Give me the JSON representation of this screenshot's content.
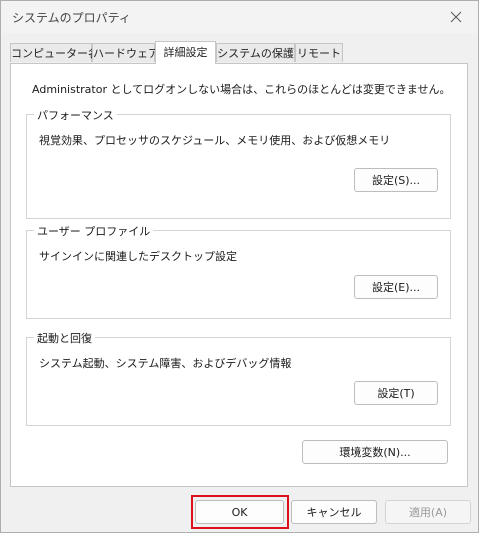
{
  "window": {
    "title": "システムのプロパティ"
  },
  "tabs": [
    {
      "label": "コンピューター名"
    },
    {
      "label": "ハードウェア"
    },
    {
      "label": "詳細設定",
      "active": true
    },
    {
      "label": "システムの保護"
    },
    {
      "label": "リモート"
    }
  ],
  "panel": {
    "note": "Administrator としてログオンしない場合は、これらのほとんどは変更できません。",
    "performance": {
      "legend": "パフォーマンス",
      "description": "視覚効果、プロセッサのスケジュール、メモリ使用、および仮想メモリ",
      "button": "設定(S)..."
    },
    "user_profile": {
      "legend": "ユーザー プロファイル",
      "description": "サインインに関連したデスクトップ設定",
      "button": "設定(E)..."
    },
    "startup_recovery": {
      "legend": "起動と回復",
      "description": "システム起動、システム障害、およびデバッグ情報",
      "button": "設定(T)"
    },
    "env_button": "環境変数(N)..."
  },
  "footer": {
    "ok": "OK",
    "cancel": "キャンセル",
    "apply": "適用(A)"
  },
  "colors": {
    "highlight": "#e0101a",
    "window_bg": "#f0f0f0",
    "panel_bg": "#ffffff"
  }
}
